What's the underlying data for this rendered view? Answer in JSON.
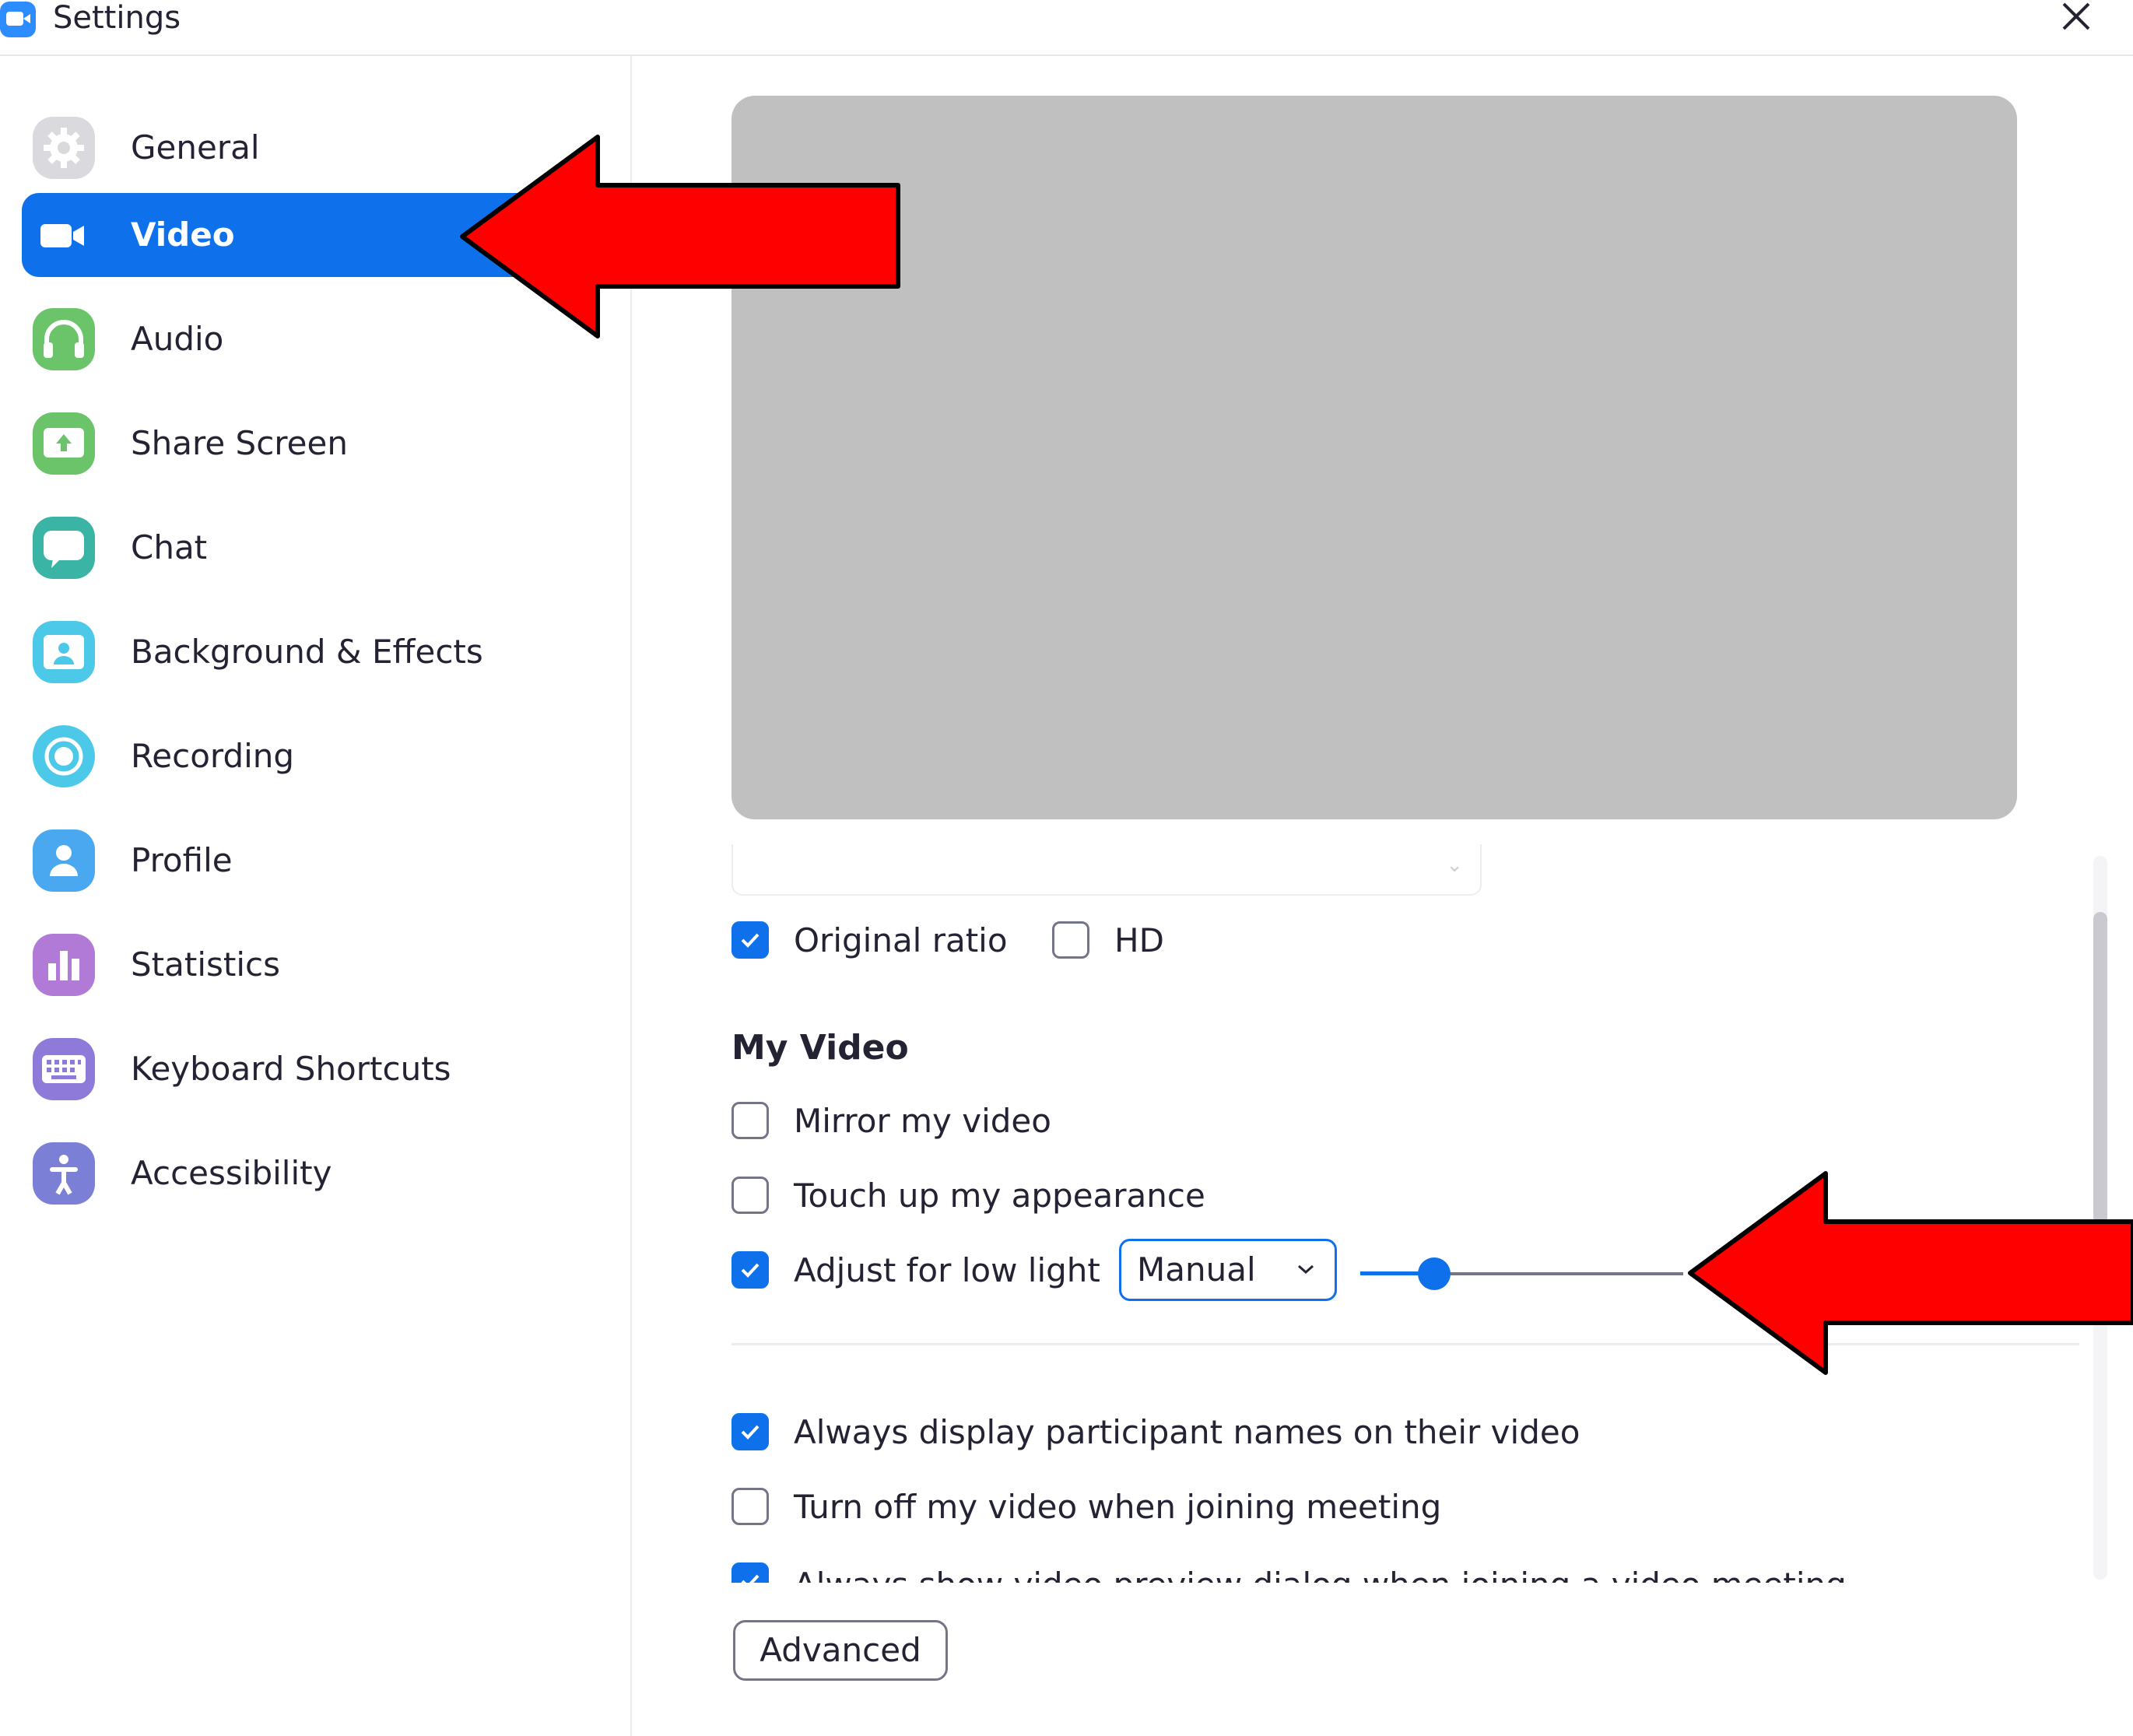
{
  "window": {
    "title": "Settings"
  },
  "sidebar": {
    "items": [
      {
        "label": "General",
        "icon": "gear-icon",
        "color": "#d9d9de",
        "active": false
      },
      {
        "label": "Video",
        "icon": "video-camera-icon",
        "color": "#0e71eb",
        "active": true
      },
      {
        "label": "Audio",
        "icon": "headphones-icon",
        "color": "#6cc46a",
        "active": false
      },
      {
        "label": "Share Screen",
        "icon": "share-screen-icon",
        "color": "#6cc46a",
        "active": false
      },
      {
        "label": "Chat",
        "icon": "chat-bubble-icon",
        "color": "#3ab5a5",
        "active": false
      },
      {
        "label": "Background & Effects",
        "icon": "background-person-icon",
        "color": "#4cc9e8",
        "active": false
      },
      {
        "label": "Recording",
        "icon": "record-icon",
        "color": "#4cc9e8",
        "active": false
      },
      {
        "label": "Profile",
        "icon": "profile-person-icon",
        "color": "#4aa8f0",
        "active": false
      },
      {
        "label": "Statistics",
        "icon": "bar-chart-icon",
        "color": "#b07ad6",
        "active": false
      },
      {
        "label": "Keyboard Shortcuts",
        "icon": "keyboard-icon",
        "color": "#8e7ad9",
        "active": false
      },
      {
        "label": "Accessibility",
        "icon": "accessibility-icon",
        "color": "#7b7fd6",
        "active": false
      }
    ]
  },
  "video": {
    "original_ratio": {
      "label": "Original ratio",
      "checked": true
    },
    "hd": {
      "label": "HD",
      "checked": false
    },
    "my_video_title": "My Video",
    "mirror": {
      "label": "Mirror my video",
      "checked": false
    },
    "touch_up": {
      "label": "Touch up my appearance",
      "checked": false
    },
    "low_light": {
      "label": "Adjust for low light",
      "checked": true
    },
    "low_light_mode": "Manual",
    "low_light_level": 0.23,
    "names": {
      "label": "Always display participant names on their video",
      "checked": true
    },
    "turn_off": {
      "label": "Turn off my video when joining meeting",
      "checked": false
    },
    "preview_dialog": {
      "label": "Always show video preview dialog when joining a video meeting",
      "checked": true
    },
    "advanced_label": "Advanced"
  },
  "colors": {
    "accent": "#0e71eb",
    "annotation_arrow": "#ff0000"
  }
}
